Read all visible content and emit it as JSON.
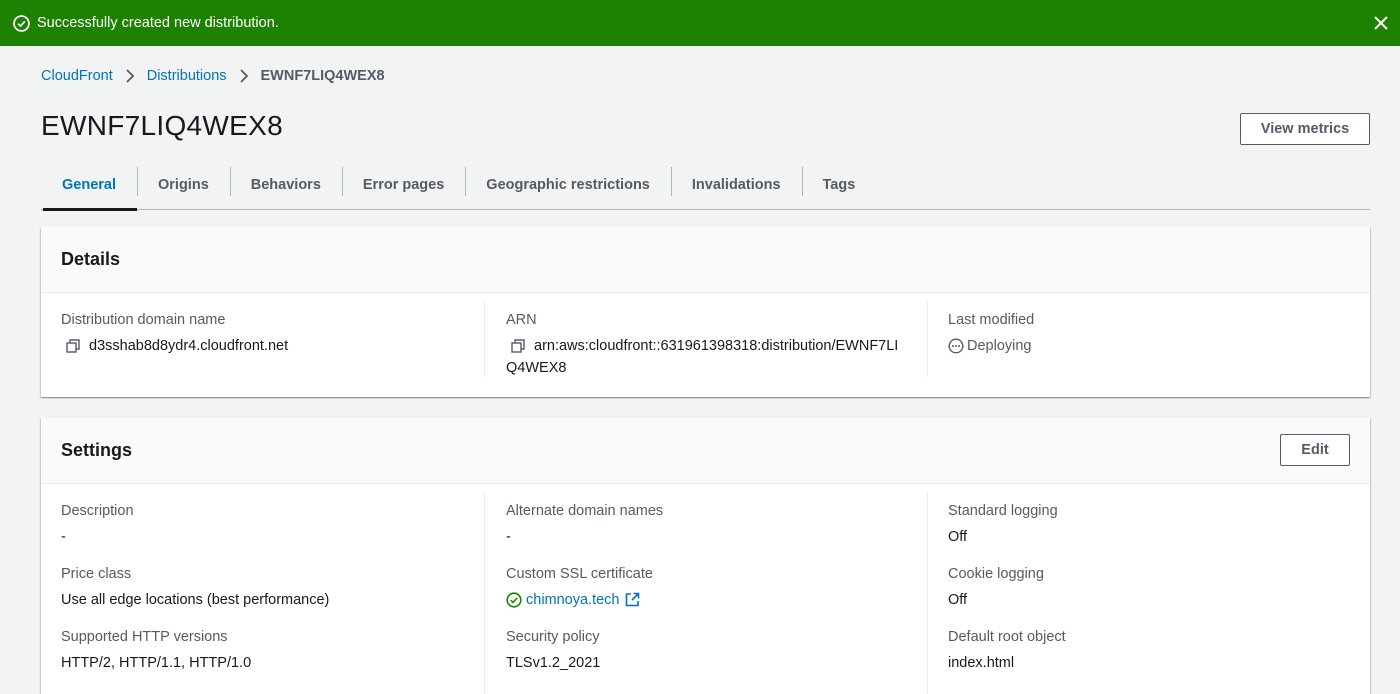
{
  "flash": {
    "message": "Successfully created new distribution."
  },
  "breadcrumb": {
    "items": [
      "CloudFront",
      "Distributions"
    ],
    "current": "EWNF7LIQ4WEX8"
  },
  "page": {
    "title": "EWNF7LIQ4WEX8",
    "view_metrics": "View metrics"
  },
  "tabs": [
    "General",
    "Origins",
    "Behaviors",
    "Error pages",
    "Geographic restrictions",
    "Invalidations",
    "Tags"
  ],
  "details": {
    "title": "Details",
    "domain_label": "Distribution domain name",
    "domain_value": "d3sshab8d8ydr4.cloudfront.net",
    "arn_label": "ARN",
    "arn_line1": "arn:aws:cloudfront::631961398318:distribution/EWNF7LI",
    "arn_line2": "Q4WEX8",
    "modified_label": "Last modified",
    "modified_value": "Deploying"
  },
  "settings": {
    "title": "Settings",
    "edit": "Edit",
    "col1": [
      {
        "label": "Description",
        "value": "-"
      },
      {
        "label": "Price class",
        "value": "Use all edge locations (best performance)"
      },
      {
        "label": "Supported HTTP versions",
        "value": "HTTP/2, HTTP/1.1, HTTP/1.0"
      }
    ],
    "col2": [
      {
        "label": "Alternate domain names",
        "value": "-"
      },
      {
        "label": "Custom SSL certificate",
        "value": "chimnoya.tech"
      },
      {
        "label": "Security policy",
        "value": "TLSv1.2_2021"
      }
    ],
    "col3": [
      {
        "label": "Standard logging",
        "value": "Off"
      },
      {
        "label": "Cookie logging",
        "value": "Off"
      },
      {
        "label": "Default root object",
        "value": "index.html"
      }
    ]
  },
  "colors": {
    "success": "#1d8102",
    "link": "#0073bb",
    "text": "#16191f",
    "muted": "#545b64"
  },
  "icons": [
    "check-circle-icon",
    "close-icon",
    "chevron-right-icon",
    "copy-icon",
    "pending-icon",
    "external-link-icon"
  ]
}
